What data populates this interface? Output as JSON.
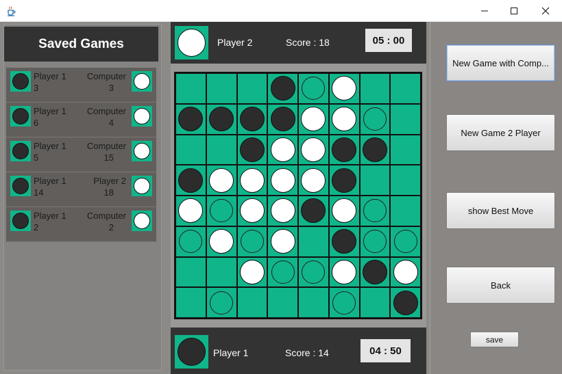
{
  "window": {
    "icon": "java-coffee-cup-icon"
  },
  "saved_games": {
    "title": "Saved Games",
    "items": [
      {
        "left_name": "Player 1",
        "left_score": "3",
        "right_name": "Computer",
        "right_score": "3"
      },
      {
        "left_name": "Player 1",
        "left_score": "6",
        "right_name": "Computer",
        "right_score": "4"
      },
      {
        "left_name": "Player 1",
        "left_score": "5",
        "right_name": "Computer",
        "right_score": "15"
      },
      {
        "left_name": "Player 1",
        "left_score": "14",
        "right_name": "Player 2",
        "right_score": "18"
      },
      {
        "left_name": "Player 1",
        "left_score": "2",
        "right_name": "Computer",
        "right_score": "2"
      }
    ]
  },
  "top_player": {
    "name": "Player 2",
    "score": "Score : 18",
    "timer": "05 : 00",
    "disc": "white"
  },
  "bottom_player": {
    "name": "Player 1",
    "score": "Score : 14",
    "timer": "04 : 50",
    "disc": "black"
  },
  "board": {
    "rows": [
      [
        "",
        "",
        "",
        "B",
        "H",
        "W",
        "",
        ""
      ],
      [
        "B",
        "B",
        "B",
        "B",
        "W",
        "W",
        "H",
        ""
      ],
      [
        "",
        "",
        "B",
        "W",
        "W",
        "B",
        "B",
        ""
      ],
      [
        "B",
        "W",
        "W",
        "W",
        "W",
        "B",
        "",
        ""
      ],
      [
        "W",
        "H",
        "W",
        "W",
        "B",
        "W",
        "H",
        ""
      ],
      [
        "H",
        "W",
        "H",
        "W",
        "",
        "B",
        "H",
        "H"
      ],
      [
        "",
        "",
        "W",
        "H",
        "H",
        "W",
        "B",
        "W"
      ],
      [
        "",
        "H",
        "",
        "",
        "",
        "H",
        "",
        "B"
      ]
    ]
  },
  "buttons": {
    "new_game_computer": "New Game with Comp...",
    "new_game_2player": "New Game 2 Player",
    "show_best_move": "show Best Move",
    "back": "Back",
    "save": "save"
  },
  "colors": {
    "board_green": "#11b58a",
    "panel_dark": "#333333"
  }
}
